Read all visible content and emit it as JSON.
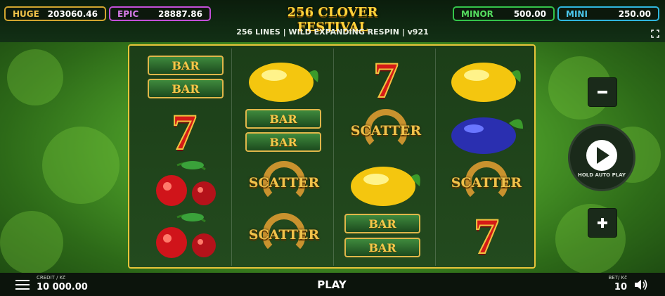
{
  "jackpots": {
    "huge": {
      "label": "HUGE",
      "value": "203060.46",
      "color": "#d2a52f"
    },
    "epic": {
      "label": "EPIC",
      "value": "28887.86",
      "color": "#c34fd8"
    },
    "minor": {
      "label": "MINOR",
      "value": "500.00",
      "color": "#34c44a"
    },
    "mini": {
      "label": "MINI",
      "value": "250.00",
      "color": "#2fb6de"
    }
  },
  "game": {
    "title": "256 CLOVER FESTIVAL",
    "subtitle": "256 LINES  |  WILD EXPANDING RESPIN | v921"
  },
  "reels": {
    "col1": [
      "BAR",
      "BAR",
      "seven",
      "cherries",
      "cherries"
    ],
    "col2": [
      "lemon",
      "BAR",
      "BAR",
      "SCATTER",
      "SCATTER"
    ],
    "col3": [
      "seven",
      "SCATTER",
      "lemon",
      "BAR",
      "BAR"
    ],
    "col4": [
      "lemon",
      "plum",
      "SCATTER",
      "seven"
    ],
    "labels": {
      "bar": "BAR",
      "scatter": "SCATTER",
      "seven": "7"
    }
  },
  "controls": {
    "minus_icon": "minus-icon",
    "plus_icon": "plus-icon",
    "autoplay_label": "HOLD AUTO PLAY",
    "play_label": "PLAY"
  },
  "footer": {
    "credit_label": "CREDIT / Kč",
    "credit_value": "10 000.00",
    "bet_label": "BET/ Kč",
    "bet_value": "10",
    "menu_icon": "menu-icon",
    "sound_icon": "speaker-icon"
  }
}
